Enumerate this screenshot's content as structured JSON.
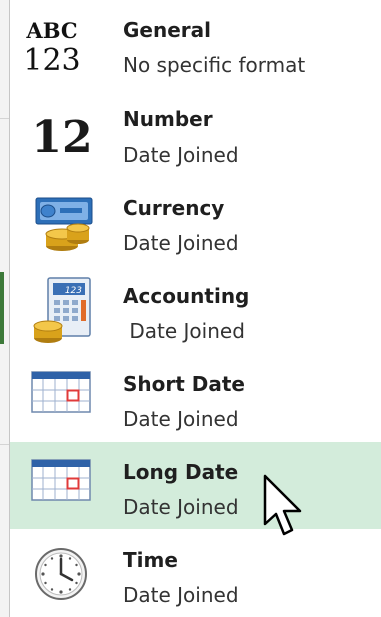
{
  "menu": {
    "items": [
      {
        "label": "General",
        "description": "No specific format",
        "icon": "abc-123-icon"
      },
      {
        "label": "Number",
        "description": "Date Joined",
        "icon": "number-12-icon"
      },
      {
        "label": "Currency",
        "description": "Date Joined",
        "icon": "currency-icon"
      },
      {
        "label": "Accounting",
        "description": " Date Joined",
        "icon": "accounting-icon"
      },
      {
        "label": "Short Date",
        "description": "Date Joined",
        "icon": "calendar-icon"
      },
      {
        "label": "Long Date",
        "description": "Date Joined",
        "icon": "calendar-icon",
        "selected": true
      },
      {
        "label": "Time",
        "description": "Date Joined",
        "icon": "clock-icon"
      }
    ]
  },
  "icons": {
    "general_abc": "ABC",
    "general_123": "123",
    "number_12": "12",
    "accounting_123": "123"
  },
  "colors": {
    "selected_background": "#d3ecdb",
    "calendar_header": "#2f62a8",
    "calendar_marker": "#e03a3a",
    "coin_gold": "#d9a21b",
    "bill_blue": "#2d6fb8"
  }
}
